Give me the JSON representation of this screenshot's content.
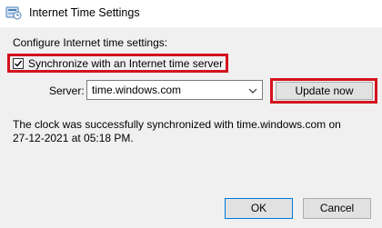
{
  "window": {
    "title": "Internet Time Settings",
    "icon": "settings-dialog-icon"
  },
  "content": {
    "section_label": "Configure Internet time settings:",
    "sync": {
      "label": "Synchronize with an Internet time server",
      "checked": true
    },
    "server": {
      "label": "Server:",
      "value": "time.windows.com"
    },
    "update_button": "Update now",
    "status_line1": "The clock was successfully synchronized with time.windows.com on",
    "status_line2": "27-12-2021 at 05:18 PM."
  },
  "footer": {
    "ok_label": "OK",
    "cancel_label": "Cancel"
  },
  "colors": {
    "highlight": "#d4121f",
    "default_button_border": "#0078d7"
  }
}
